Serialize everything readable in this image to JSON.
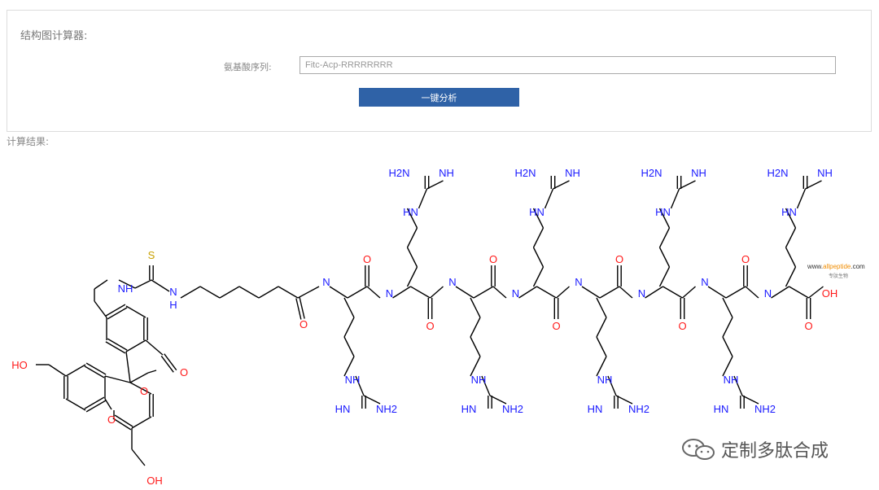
{
  "calculator": {
    "title": "结构图计算器:",
    "sequence_label": "氨基酸序列:",
    "sequence_value": "Fitc-Acp-RRRRRRRR",
    "analyze_button": "一键分析"
  },
  "results": {
    "label": "计算结果:"
  },
  "structure": {
    "fitc": {
      "ho_left": "HO",
      "oh_bottom": "OH",
      "ring_o": "O",
      "lactone_o": "O",
      "carbonyl_o": "O",
      "s": "S",
      "nh_1": "NH",
      "nh_2": "N",
      "nh_2_h": "H"
    },
    "acp": {
      "carbonyl_o": "O"
    },
    "peptide": {
      "amide_n": "N",
      "amide_h": "H",
      "carbonyl_o": "O",
      "guanidino_nh": "NH",
      "guanidino_h2n": "H2N",
      "guanidino_imine": "NH",
      "guanidino_hn": "HN",
      "guanidino_nh2": "NH2",
      "terminal_oh": "OH"
    }
  },
  "watermark": {
    "site_prefix": "www.",
    "site_name": "allpeptide",
    "site_suffix": ".com",
    "site_sub": "专肽生物",
    "wechat_text": "定制多肽合成"
  },
  "colors": {
    "button": "#2f62a7",
    "nitrogen": "#1a1aff",
    "oxygen": "#ff1a1a",
    "sulfur": "#c8a000",
    "bond": "#000000"
  }
}
